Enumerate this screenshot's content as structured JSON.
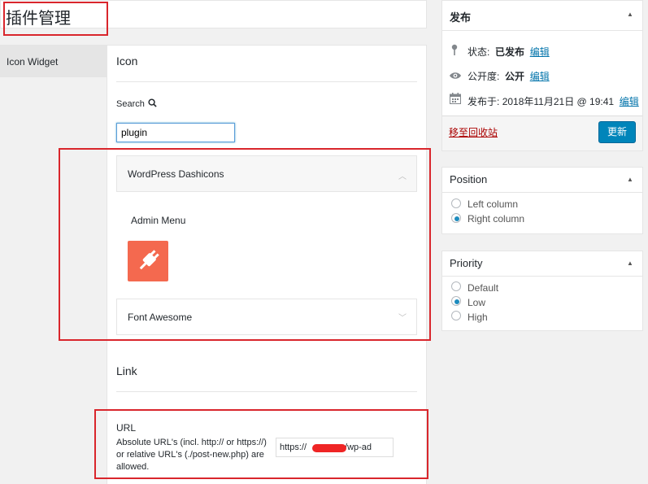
{
  "header": {
    "title": "插件管理"
  },
  "sidebar": {
    "tab_label": "Icon Widget"
  },
  "icon_section": {
    "title": "Icon",
    "search_label": "Search",
    "search_value": "plugin",
    "libraries": [
      {
        "label": "WordPress Dashicons",
        "expanded": true,
        "group_label": "Admin Menu",
        "icon": "plug-icon"
      },
      {
        "label": "Font Awesome",
        "expanded": false
      }
    ]
  },
  "link_section": {
    "title": "Link",
    "url_label": "URL",
    "url_help": "Absolute URL's (incl. http:// or https://) or relative URL's (./post-new.php) are allowed.",
    "url_value_prefix": "https://",
    "url_value_suffix": "yz/wp-ad"
  },
  "publish_box": {
    "title": "发布",
    "status_label": "状态:",
    "status_value": "已发布",
    "visibility_label": "公开度:",
    "visibility_value": "公开",
    "edit_label": "编辑",
    "published_label": "发布于:",
    "published_value": "2018年11月21日 @ 19:41",
    "trash_label": "移至回收站",
    "update_label": "更新"
  },
  "position_box": {
    "title": "Position",
    "options": [
      "Left column",
      "Right column"
    ],
    "selected": "Right column"
  },
  "priority_box": {
    "title": "Priority",
    "options": [
      "Default",
      "Low",
      "High"
    ],
    "selected": "Low"
  },
  "colors": {
    "accent": "#0085ba",
    "icon_tile": "#f4694f",
    "annotation": "#d9262c",
    "link": "#0073aa"
  }
}
